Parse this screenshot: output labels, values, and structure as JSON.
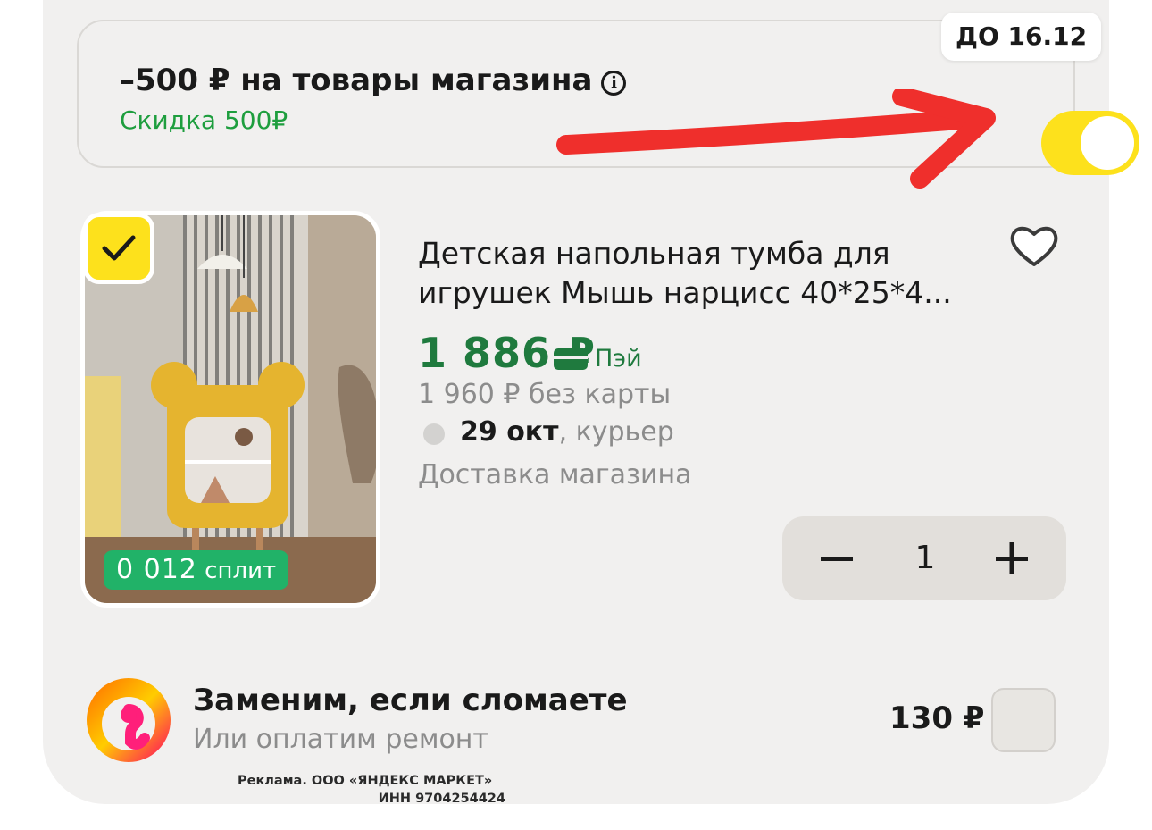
{
  "promo": {
    "title": "–500 ₽ на товары магазина",
    "subtitle": "Скидка 500₽",
    "deadline": "ДО 16.12",
    "toggle_on": true,
    "accent_color": "#fde11c",
    "subtitle_color": "#1e9e3e"
  },
  "product": {
    "title_line1": "Детская напольная тумба для",
    "title_line2": "игрушек Мышь нарцисс 40*25*4...",
    "price": "1 886 ₽",
    "pay_label": "Пэй",
    "old_price": "1 960 ₽ без карты",
    "delivery_date": "29 окт",
    "delivery_method": ", курьер",
    "delivery_source": "Доставка магазина",
    "split_amount": "0 012",
    "split_label": "сплит",
    "selected": true,
    "quantity": "1",
    "price_color": "#1f7a3e"
  },
  "protection": {
    "title": "Заменим, если сломаете",
    "subtitle": "Или оплатим ремонт",
    "price": "130 ₽",
    "checked": false
  },
  "ad": {
    "line1": "Реклама. ООО «ЯНДЕКС МАРКЕТ»",
    "line2": "ИНН 9704254424"
  },
  "icons": {
    "info": "info-icon",
    "favorite": "heart-icon",
    "check": "checkmark-icon",
    "minus": "minus-icon",
    "plus": "plus-icon",
    "pay": "card-icon"
  }
}
